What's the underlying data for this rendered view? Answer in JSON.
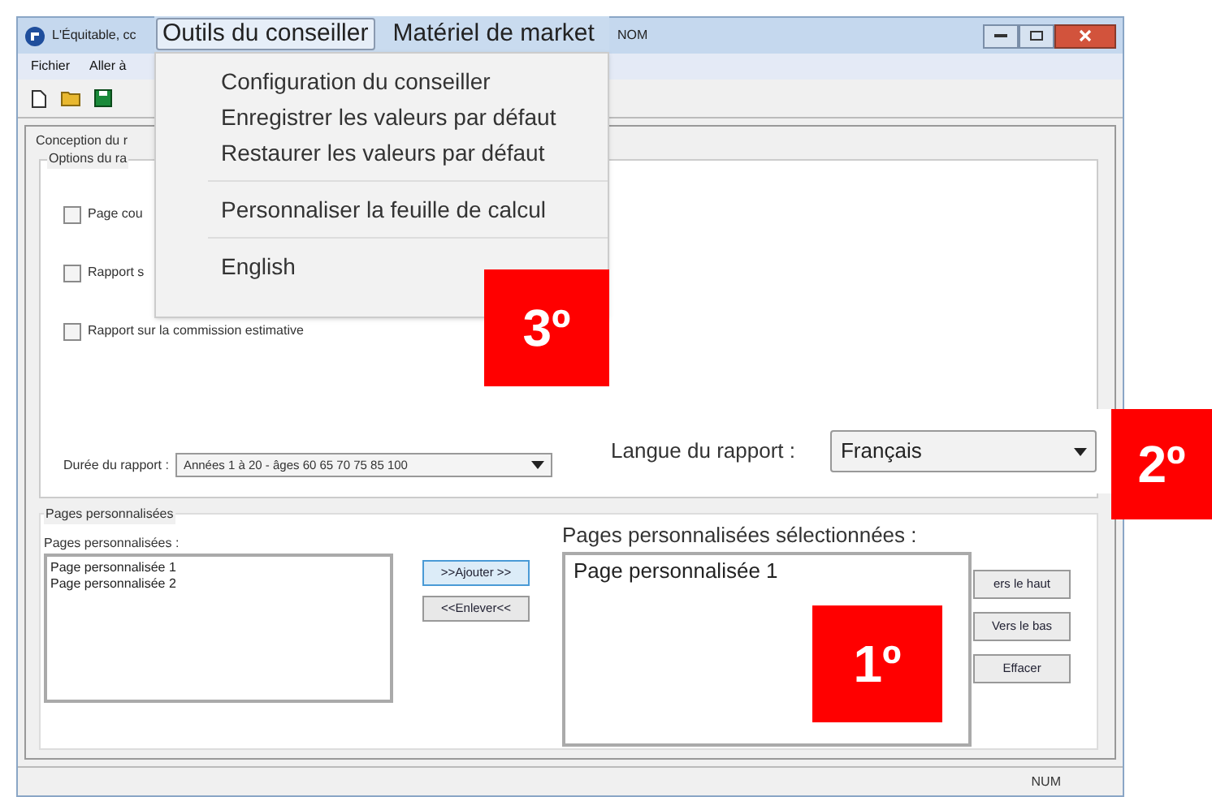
{
  "window": {
    "title": "L'Équitable, cc",
    "title_right": "NOM"
  },
  "menu_bar": [
    "Fichier",
    "Aller à"
  ],
  "enlarged_menu": [
    {
      "label": "Outils du conseiller",
      "selected": true
    },
    {
      "label": "Matériel de market",
      "selected": false
    }
  ],
  "dropdown": [
    {
      "kind": "item",
      "label": "Configuration du conseiller"
    },
    {
      "kind": "item",
      "label": "Enregistrer les valeurs par défaut"
    },
    {
      "kind": "item",
      "label": "Restaurer les valeurs par défaut"
    },
    {
      "kind": "separator"
    },
    {
      "kind": "item",
      "label": "Personnaliser la feuille de calcul"
    },
    {
      "kind": "separator"
    },
    {
      "kind": "item",
      "label": "English"
    }
  ],
  "tab_label": "Conception du r",
  "options_group": {
    "title": "Options du ra",
    "checkboxes": [
      {
        "label": "Page cou",
        "checked": false
      },
      {
        "label": "Rapport s",
        "checked": false
      },
      {
        "label": "Rapport sur la commission estimative",
        "checked": false
      }
    ]
  },
  "duration": {
    "label": "Durée du rapport :",
    "value": "Années 1 à 20 - âges 60 65 70 75 85 100"
  },
  "language": {
    "label": "Langue du rapport :",
    "value": "Français"
  },
  "custom_pages": {
    "title": "Pages personnalisées",
    "available_label": "Pages personnalisées :",
    "available": [
      "Page personnalisée 1",
      "Page personnalisée 2"
    ],
    "add_button": ">>Ajouter >>",
    "remove_button": "<<Enlever<<",
    "selected_label": "Pages personnalisées sélectionnées :",
    "selected_items": [
      "Page personnalisée 1"
    ],
    "buttons": [
      "ers le haut",
      "Vers le bas",
      "Effacer"
    ]
  },
  "callouts": [
    "3º",
    "2º",
    "1º"
  ],
  "status_bar": "NUM"
}
